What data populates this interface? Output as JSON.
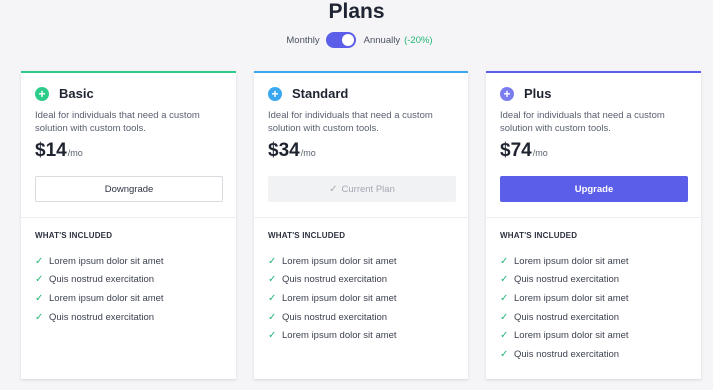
{
  "page": {
    "title": "Plans"
  },
  "billing": {
    "monthly_label": "Monthly",
    "annually_label": "Annually",
    "discount": "(-20%)",
    "annual_selected": true
  },
  "included_heading": "WHAT'S INCLUDED",
  "colors": {
    "accent": "#5b5ee8",
    "basic": "#2ecc8a",
    "standard": "#3aa8f0",
    "plus": "#7b7cf0",
    "check": "#22b573"
  },
  "plans": [
    {
      "name": "Basic",
      "description": "Ideal for individuals that need a custom solution with custom tools.",
      "price": "$14",
      "period": "/mo",
      "button_label": "Downgrade",
      "button_style": "outline",
      "icon": "plus-circle-icon",
      "features": [
        "Lorem ipsum dolor sit amet",
        "Quis nostrud exercitation",
        "Lorem ipsum dolor sit amet",
        "Quis nostrud exercitation"
      ]
    },
    {
      "name": "Standard",
      "description": "Ideal for individuals that need a custom solution with custom tools.",
      "price": "$34",
      "period": "/mo",
      "button_label": "Current Plan",
      "button_style": "current",
      "icon": "plus-circle-icon",
      "features": [
        "Lorem ipsum dolor sit amet",
        "Quis nostrud exercitation",
        "Lorem ipsum dolor sit amet",
        "Quis nostrud exercitation",
        "Lorem ipsum dolor sit amet"
      ]
    },
    {
      "name": "Plus",
      "description": "Ideal for individuals that need a custom solution with custom tools.",
      "price": "$74",
      "period": "/mo",
      "button_label": "Upgrade",
      "button_style": "primary",
      "icon": "plus-circle-icon",
      "features": [
        "Lorem ipsum dolor sit amet",
        "Quis nostrud exercitation",
        "Lorem ipsum dolor sit amet",
        "Quis nostrud exercitation",
        "Lorem ipsum dolor sit amet",
        "Quis nostrud exercitation"
      ]
    }
  ]
}
